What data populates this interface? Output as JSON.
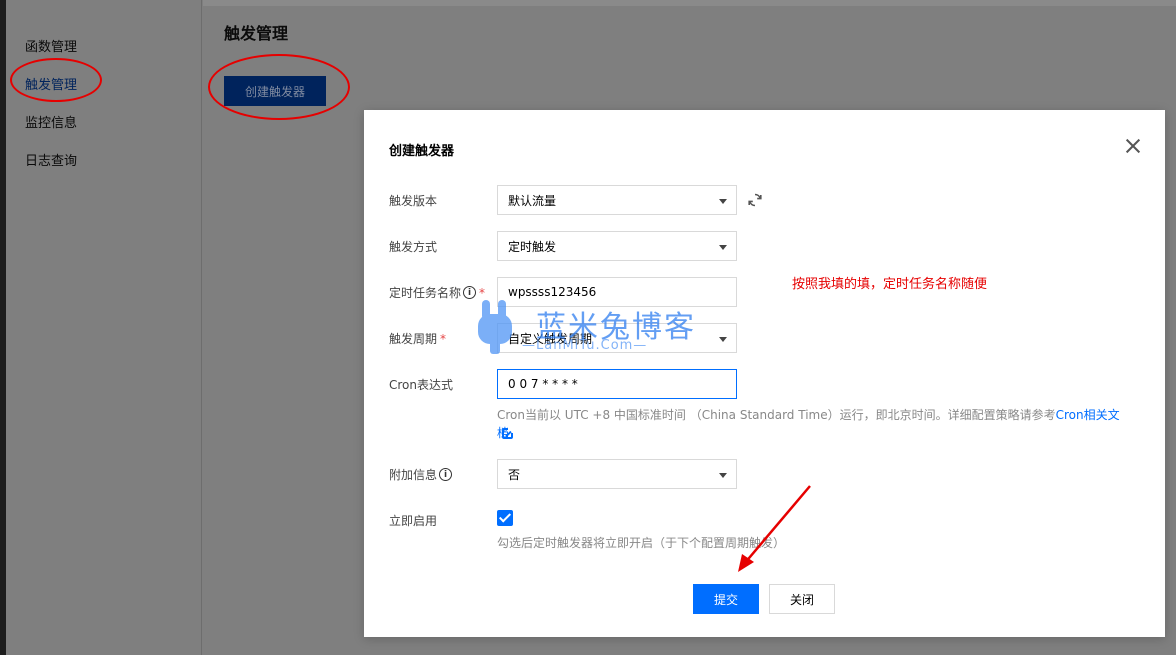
{
  "sidebar": {
    "items": [
      {
        "label": "函数管理"
      },
      {
        "label": "触发管理"
      },
      {
        "label": "监控信息"
      },
      {
        "label": "日志查询"
      }
    ]
  },
  "main": {
    "title": "触发管理",
    "create_button": "创建触发器"
  },
  "modal": {
    "title": "创建触发器",
    "fields": {
      "version": {
        "label": "触发版本",
        "value": "默认流量"
      },
      "method": {
        "label": "触发方式",
        "value": "定时触发"
      },
      "task_name": {
        "label": "定时任务名称",
        "value": "wpssss123456"
      },
      "period": {
        "label": "触发周期",
        "value": "自定义触发周期"
      },
      "cron": {
        "label": "Cron表达式",
        "value": "0 0 7 * * * *"
      },
      "extra": {
        "label": "附加信息",
        "value": "否"
      },
      "enable": {
        "label": "立即启用"
      }
    },
    "cron_hint": "Cron当前以 UTC +8 中国标准时间 （China Standard Time）运行，即北京时间。详细配置策略请参考",
    "cron_link": "Cron相关文档",
    "enable_hint": "勾选后定时触发器将立即开启（于下个配置周期触发）",
    "submit": "提交",
    "close": "关闭"
  },
  "annotation": {
    "note": "按照我填的填，定时任务名称随便"
  },
  "watermark": {
    "cn": "蓝米兔博客",
    "en": "—LanMiTu.Com—"
  },
  "colors": {
    "primary": "#006eff",
    "annotation": "#e60000",
    "required": "#e54545"
  }
}
